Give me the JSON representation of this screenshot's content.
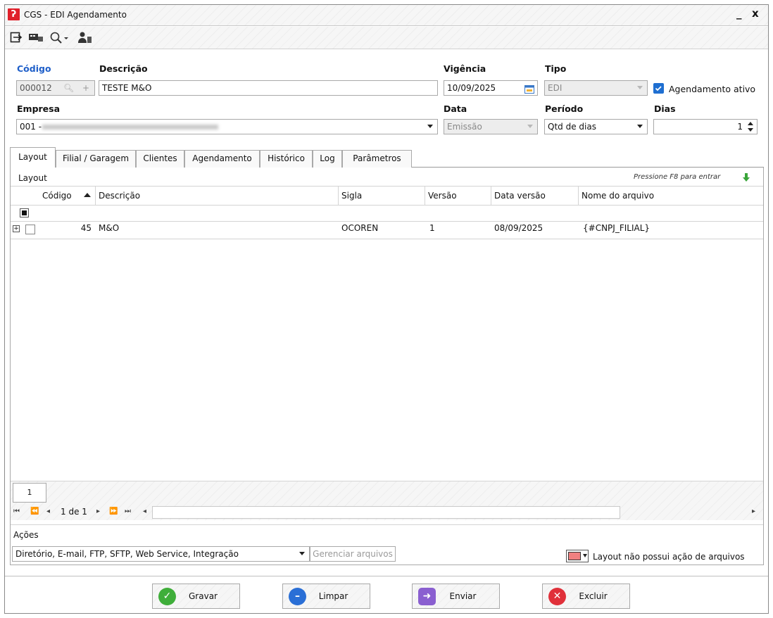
{
  "window": {
    "title": "CGS - EDI Agendamento",
    "minimize": "_",
    "close": "x"
  },
  "toolbar": {
    "icons": [
      "exit-icon",
      "message-icon",
      "search-icon",
      "user-icon"
    ]
  },
  "form": {
    "codigo_label": "Código",
    "codigo_value": "000012",
    "descricao_label": "Descrição",
    "descricao_value": "TESTE M&O",
    "vigencia_label": "Vigência",
    "vigencia_value": "10/09/2025",
    "tipo_label": "Tipo",
    "tipo_value": "EDI",
    "agendamento_ativo_label": "Agendamento ativo",
    "empresa_label": "Empresa",
    "empresa_value": "001 -",
    "data_label": "Data",
    "data_value": "Emissão",
    "periodo_label": "Período",
    "periodo_value": "Qtd de dias",
    "dias_label": "Dias",
    "dias_value": "1"
  },
  "tabs": [
    "Layout",
    "Filial / Garagem",
    "Clientes",
    "Agendamento",
    "Histórico",
    "Log",
    "Parâmetros"
  ],
  "grid": {
    "title": "Layout",
    "hint": "Pressione F8 para entrar",
    "columns": [
      "Código",
      "Descrição",
      "Sigla",
      "Versão",
      "Data versão",
      "Nome do arquivo"
    ],
    "rows": [
      {
        "codigo": "45",
        "descricao": "M&O",
        "sigla": "OCOREN",
        "versao": "1",
        "data_versao": "08/09/2025",
        "nome_arquivo": "{#CNPJ_FILIAL}"
      }
    ],
    "page_number": "1",
    "pager_text": "1 de 1"
  },
  "acoes": {
    "label": "Ações",
    "value": "Diretório, E-mail, FTP, SFTP, Web Service, Integração",
    "gerenciar": "Gerenciar arquivos",
    "status_text": "Layout não possui ação de arquivos",
    "status_color": "#f08080"
  },
  "buttons": {
    "gravar": "Gravar",
    "limpar": "Limpar",
    "enviar": "Enviar",
    "excluir": "Excluir"
  },
  "colors": {
    "accent": "#1f5fc9",
    "logo": "#e0202a",
    "gravar": "#3fae3a",
    "limpar": "#2a6fd6",
    "enviar": "#8a5fd0",
    "excluir": "#e0303a"
  }
}
